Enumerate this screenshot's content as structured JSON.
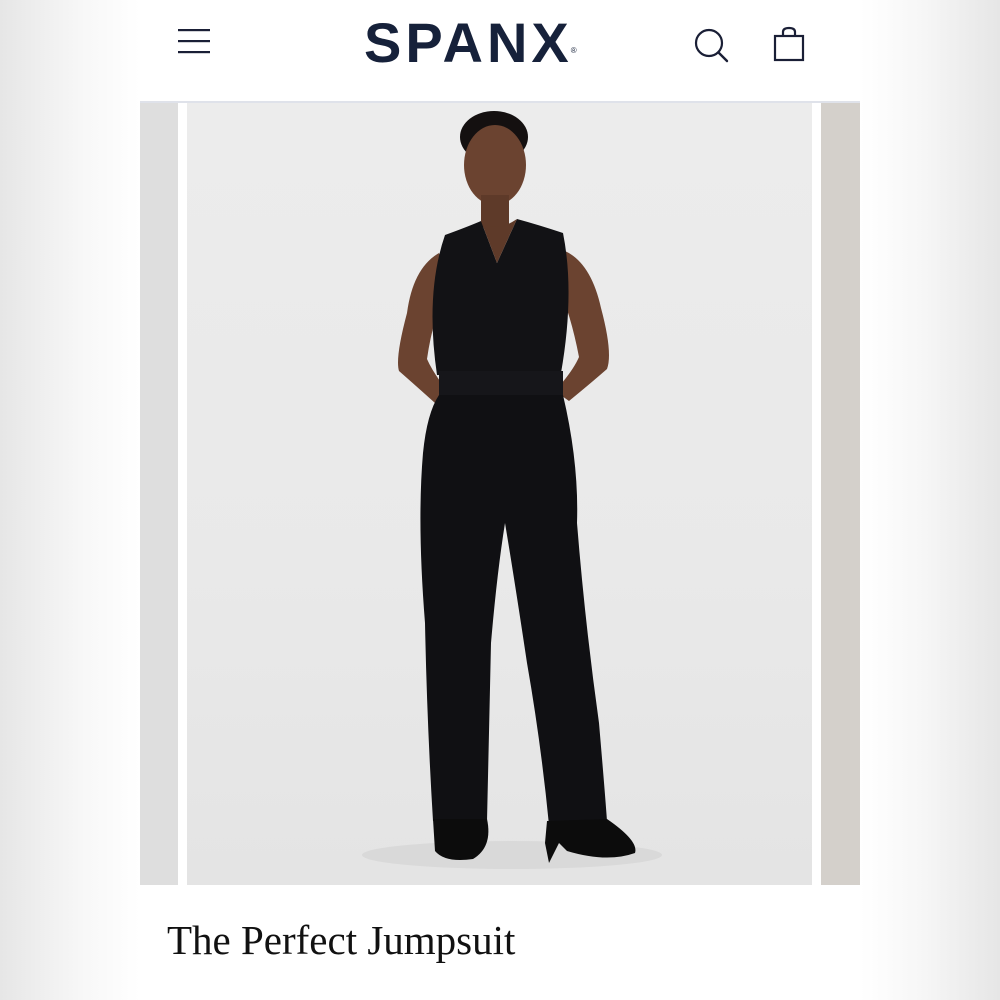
{
  "header": {
    "brand": "SPANX",
    "brand_mark": "®",
    "icons": {
      "menu": "hamburger-menu-icon",
      "search": "search-icon",
      "cart": "shopping-bag-icon"
    }
  },
  "product": {
    "title": "The Perfect Jumpsuit",
    "image": "model-wearing-black-sleeveless-v-neck-jumpsuit"
  },
  "colors": {
    "brand_navy": "#16213a",
    "text": "#111111",
    "header_divider": "#dfe2ea",
    "jumpsuit": "#111114"
  }
}
